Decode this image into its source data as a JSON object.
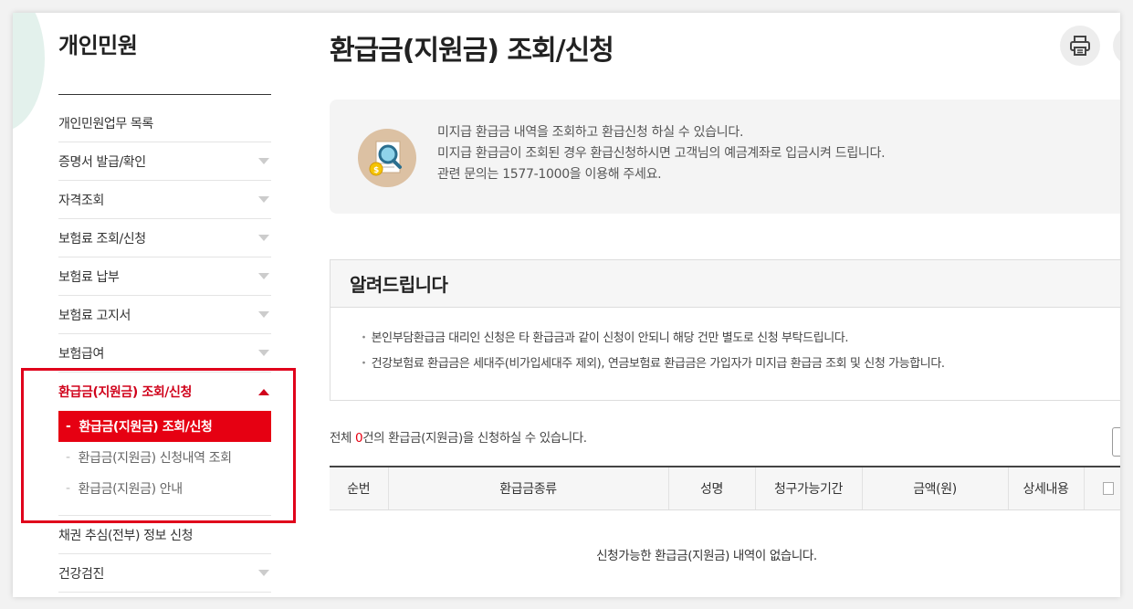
{
  "sidebar": {
    "title": "개인민원",
    "items": [
      {
        "label": "개인민원업무 목록",
        "arrow": false
      },
      {
        "label": "증명서 발급/확인",
        "arrow": true
      },
      {
        "label": "자격조회",
        "arrow": true
      },
      {
        "label": "보험료 조회/신청",
        "arrow": true
      },
      {
        "label": "보험료 납부",
        "arrow": true
      },
      {
        "label": "보험료 고지서",
        "arrow": true
      },
      {
        "label": "보험급여",
        "arrow": true
      }
    ],
    "active": {
      "label": "환급금(지원금) 조회/신청",
      "subitems": [
        {
          "label": "환급금(지원금) 조회/신청",
          "selected": true
        },
        {
          "label": "환급금(지원금) 신청내역 조회",
          "selected": false
        },
        {
          "label": "환급금(지원금) 안내",
          "selected": false
        }
      ]
    },
    "after_items": [
      {
        "label": "채권 추심(전부) 정보 신청",
        "arrow": false
      },
      {
        "label": "건강검진",
        "arrow": true
      }
    ],
    "dash": "-"
  },
  "main": {
    "title": "환급금(지원금) 조회/신청",
    "info_lines": [
      "미지급 환급금 내역을 조회하고 환급신청 하실 수 있습니다.",
      "미지급 환급금이 조회된 경우 환급신청하시면 고객님의 예금계좌로 입금시켜 드립니다.",
      "관련 문의는 1577-1000을 이용해 주세요."
    ],
    "notice": {
      "title": "알려드립니다",
      "items": [
        "본인부담환급금 대리인 신청은 타 환급금과 같이 신청이 안되니 해당 건만 별도로 신청 부탁드립니다.",
        "건강보험료 환급금은 세대주(비가입세대주 제외), 연금보험료 환급금은 가입자가 미지급 환급금 조회 및 신청 가능합니다."
      ]
    },
    "count": {
      "prefix": "전체 ",
      "num": "0",
      "suffix": "건의 환급금(지원금)을 신청하실 수 있습니다."
    },
    "table": {
      "headers": [
        "순번",
        "환급금종류",
        "성명",
        "청구가능기간",
        "금액(원)",
        "상세내용"
      ],
      "empty_message": "신청가능한 환급금(지원금) 내역이 없습니다."
    }
  },
  "colors": {
    "accent": "#e60012",
    "highlight": "#e0001b"
  }
}
